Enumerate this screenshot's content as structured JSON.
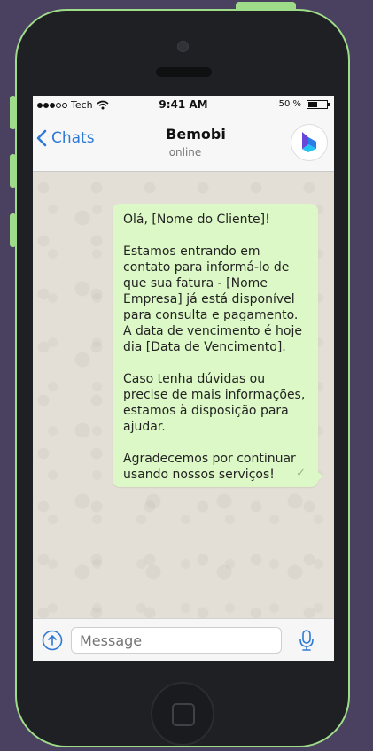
{
  "status_bar": {
    "carrier": "Tech",
    "time": "9:41 AM",
    "battery": "50 %",
    "battery_level": 0.5
  },
  "nav": {
    "back_label": "Chats",
    "contact_name": "Bemobi",
    "contact_status": "online",
    "avatar_icon": "bemobi-logo-icon"
  },
  "message": {
    "paragraphs": [
      "Olá, [Nome do Cliente]!",
      "Estamos entrando em contato para informá-lo de que sua fatura - [Nome Empresa] já está disponível para consulta e pagamento. A data de vencimento é hoje dia [Data de Vencimento].",
      "Caso tenha dúvidas ou precise de mais informações, estamos à disposição para ajudar.",
      "Agradecemos por continuar usando nossos serviços!"
    ],
    "status_icon": "check-icon"
  },
  "input": {
    "placeholder": "Message",
    "attach_icon": "upload-arrow-icon",
    "mic_icon": "microphone-icon"
  },
  "colors": {
    "device_trim": "#9fdc8a",
    "accent": "#2d7ad6",
    "bubble": "#dcf8c6"
  }
}
